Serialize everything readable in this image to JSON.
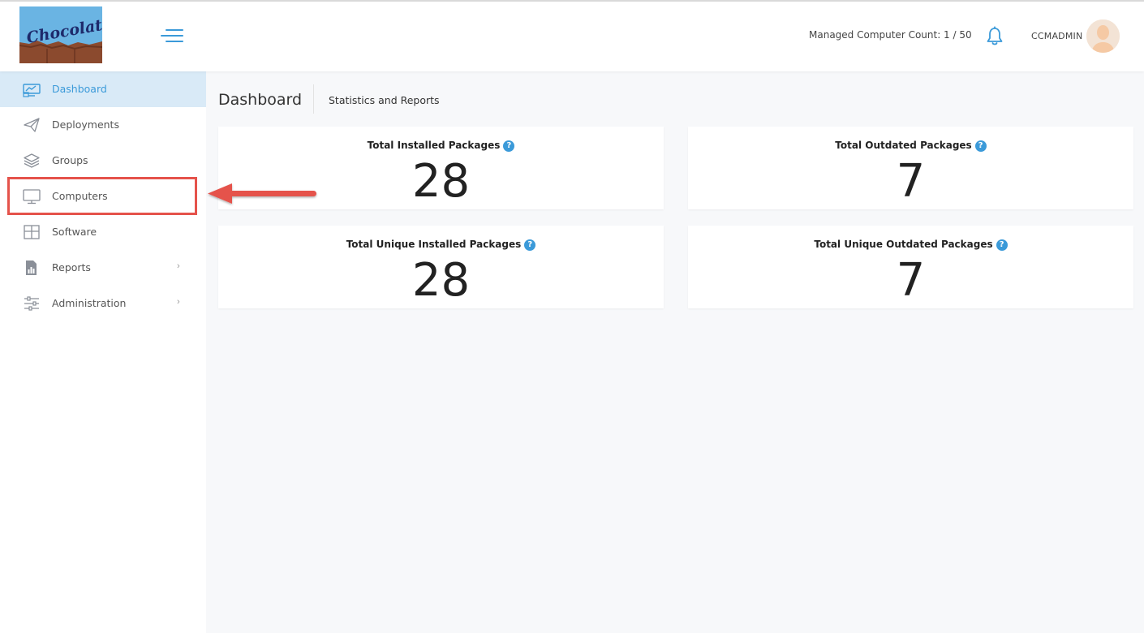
{
  "header": {
    "logo_text": "Chocolatey",
    "managed_label": "Managed Computer Count: 1 / 50",
    "username": "CCMADMIN"
  },
  "sidebar": {
    "items": [
      {
        "label": "Dashboard",
        "icon": "dashboard-icon",
        "active": true
      },
      {
        "label": "Deployments",
        "icon": "paper-plane-icon"
      },
      {
        "label": "Groups",
        "icon": "layers-icon"
      },
      {
        "label": "Computers",
        "icon": "monitor-icon"
      },
      {
        "label": "Software",
        "icon": "grid-icon"
      },
      {
        "label": "Reports",
        "icon": "report-icon",
        "chevron": "›"
      },
      {
        "label": "Administration",
        "icon": "sliders-icon",
        "chevron": "›"
      }
    ]
  },
  "page": {
    "title": "Dashboard",
    "subtitle": "Statistics and Reports"
  },
  "cards": [
    {
      "title": "Total Installed Packages",
      "value": "28"
    },
    {
      "title": "Total Outdated Packages",
      "value": "7"
    },
    {
      "title": "Total Unique Installed Packages",
      "value": "28"
    },
    {
      "title": "Total Unique Outdated Packages",
      "value": "7"
    }
  ],
  "help_glyph": "?",
  "colors": {
    "accent": "#3b9ad9",
    "active_bg": "#d9eaf7",
    "annotation": "#e5534b"
  }
}
